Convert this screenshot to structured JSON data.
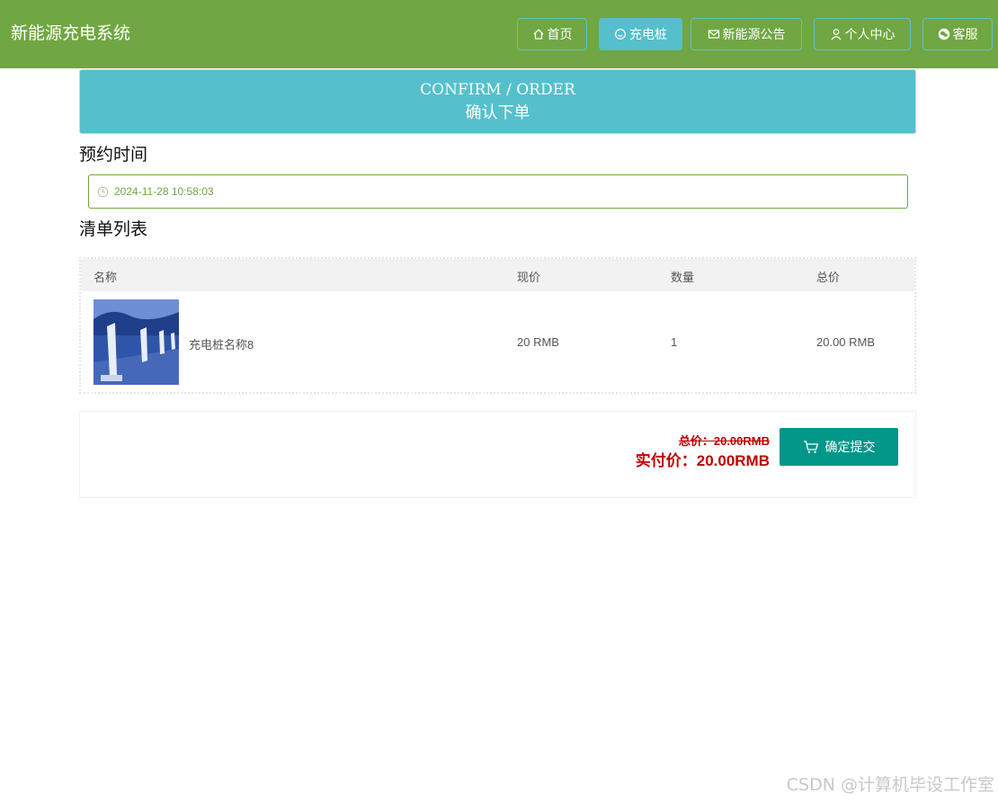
{
  "app": {
    "title": "新能源充电系统"
  },
  "nav": [
    {
      "label": "首页",
      "icon": "home-icon",
      "active": false
    },
    {
      "label": "充电桩",
      "icon": "smile-icon",
      "active": true
    },
    {
      "label": "新能源公告",
      "icon": "mail-icon",
      "active": false
    },
    {
      "label": "个人中心",
      "icon": "user-icon",
      "active": false
    },
    {
      "label": "客服",
      "icon": "wechat-icon",
      "active": false
    }
  ],
  "banner": {
    "en": "CONFIRM / ORDER",
    "cn": "确认下单"
  },
  "reservation": {
    "title": "预约时间",
    "value": "2024-11-28 10:58:03",
    "icon": "clock-icon"
  },
  "list": {
    "title": "清单列表",
    "columns": [
      "名称",
      "现价",
      "数量",
      "总价"
    ],
    "rows": [
      {
        "name": "充电桩名称8",
        "price": "20 RMB",
        "qty": "1",
        "total": "20.00 RMB"
      }
    ]
  },
  "summary": {
    "total_label": "总价：20.00RMB",
    "pay_label": "实付价：20.00RMB",
    "submit": "确定提交",
    "submit_icon": "cart-icon"
  },
  "watermark": "CSDN @计算机毕设工作室",
  "colors": {
    "header": "#70a742",
    "accent": "#55c0cc",
    "submit": "#009688",
    "price": "#c00000"
  }
}
